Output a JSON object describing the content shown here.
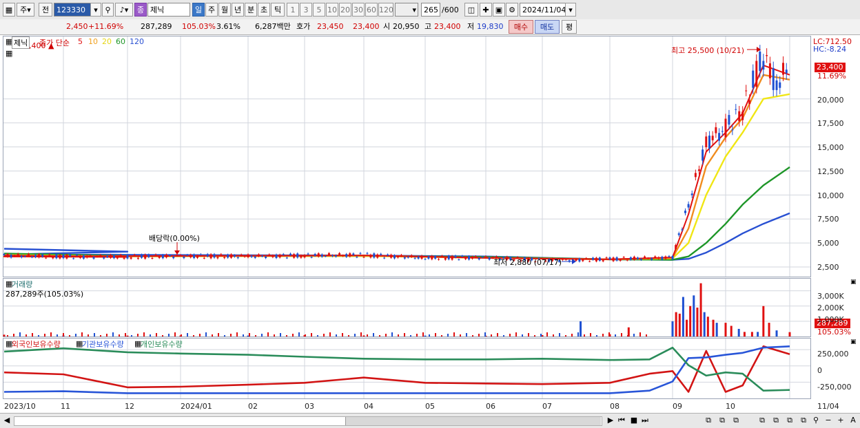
{
  "toolbar": {
    "market_label": "주",
    "prev_label": "전",
    "code": "123330",
    "name_badge": "종",
    "stock_name": "제닉",
    "periods": [
      "일",
      "주",
      "월",
      "년",
      "분",
      "초",
      "틱"
    ],
    "intervals": [
      "1",
      "3",
      "5",
      "10",
      "20",
      "30",
      "60",
      "120"
    ],
    "count": "265",
    "max_count": "/600",
    "date": "2024/11/04"
  },
  "quote": {
    "price": "23,400 ▲",
    "change": "2,450",
    "change_pct": "+11.69%",
    "volume": "287,289",
    "vol_ratio": "105.03%",
    "turnover": "3.61%",
    "amount": "6,287백만",
    "hoga_label": "호가",
    "ask": "23,450",
    "bid": "23,400",
    "open_label": "시",
    "open": "20,950",
    "high_label": "고",
    "high": "23,400",
    "low_label": "저",
    "low": "19,830",
    "buy_label": "매수",
    "sell_label": "매도",
    "avg_label": "평"
  },
  "price_panel": {
    "name": "제닉",
    "ma_title": "종가 단순",
    "ma_periods": [
      "5",
      "10",
      "20",
      "60",
      "120"
    ],
    "lc": "LC:712.50",
    "hc": "HC:-8.24",
    "high_annotation": "최고 25,500 (10/21)",
    "low_annotation": "최저 2,880 (07/17)",
    "dividend_annotation": "배당락(0.00%)",
    "current_tag": "23,400",
    "current_pct": "11.69%"
  },
  "volume_panel": {
    "title": "거래량",
    "info": "287,289주(105.03%)",
    "current_tag": "287,289",
    "current_pct": "105.03%"
  },
  "holding_panel": {
    "series_names": [
      "외국인보유수량",
      "기관보유수량",
      "개인보유수량"
    ]
  },
  "colors": {
    "ma5": "#e01010",
    "ma10": "#f08c1e",
    "ma20": "#f0e614",
    "ma60": "#1e9628",
    "ma120": "#2850d2",
    "up": "#e01010",
    "down": "#1e50d2",
    "foreign": "#d21414",
    "institution": "#2855d8",
    "individual": "#2a8c5a"
  },
  "chart_data": [
    {
      "type": "line",
      "title": "제닉 종가 단순 5 10 20 60 120",
      "categories": [
        "2023/10",
        "11",
        "12",
        "2024/01",
        "02",
        "03",
        "04",
        "05",
        "06",
        "07",
        "08",
        "09",
        "10",
        "11/04"
      ],
      "y_ticks": [
        2500,
        5000,
        7500,
        10000,
        12500,
        15000,
        17500,
        20000
      ],
      "ylim": [
        1500,
        26500
      ],
      "grid": true,
      "series": [
        {
          "name": "종가",
          "x": [
            "2023/10",
            "11",
            "12",
            "2024/01",
            "02",
            "03",
            "04",
            "05",
            "06",
            "07",
            "08",
            "09-01",
            "09-10",
            "09-20",
            "10-01",
            "10-10",
            "10-21",
            "10-28",
            "11/04"
          ],
          "values": [
            3700,
            3600,
            3550,
            3650,
            3600,
            3700,
            3750,
            3450,
            3500,
            3200,
            3300,
            3500,
            9000,
            15500,
            17000,
            18800,
            24500,
            21500,
            23400
          ]
        },
        {
          "name": "5",
          "x": [
            "2023/10",
            "12",
            "2024/02",
            "04",
            "06",
            "08",
            "09-01",
            "09-10",
            "09-20",
            "10-01",
            "10-10",
            "10-21",
            "11/04"
          ],
          "values": [
            3700,
            3550,
            3600,
            3700,
            3450,
            3300,
            3500,
            8000,
            14500,
            16500,
            18500,
            23500,
            22500
          ]
        },
        {
          "name": "10",
          "x": [
            "2023/10",
            "12",
            "2024/02",
            "04",
            "06",
            "08",
            "09-01",
            "09-10",
            "09-20",
            "10-01",
            "10-10",
            "10-21",
            "11/04"
          ],
          "values": [
            3700,
            3550,
            3600,
            3700,
            3450,
            3300,
            3450,
            6500,
            13000,
            16000,
            18000,
            22500,
            22000
          ]
        },
        {
          "name": "20",
          "x": [
            "2023/10",
            "12",
            "2024/02",
            "04",
            "06",
            "08",
            "09-01",
            "09-10",
            "09-20",
            "10-01",
            "10-10",
            "10-21",
            "11/04"
          ],
          "values": [
            3750,
            3600,
            3600,
            3650,
            3450,
            3300,
            3400,
            5000,
            10000,
            14000,
            16500,
            20000,
            20500
          ]
        },
        {
          "name": "60",
          "x": [
            "2023/10",
            "12",
            "2024/02",
            "04",
            "06",
            "08",
            "09-01",
            "09-10",
            "09-20",
            "10-01",
            "10-10",
            "10-21",
            "11/04"
          ],
          "values": [
            3900,
            3650,
            3600,
            3650,
            3550,
            3300,
            3250,
            3600,
            5000,
            7000,
            9000,
            11000,
            12900
          ]
        },
        {
          "name": "120",
          "x": [
            "2023/10",
            "12",
            "2024/02",
            "04",
            "06",
            "08",
            "09-01",
            "09-10",
            "09-20",
            "10-01",
            "10-10",
            "10-21",
            "11/04"
          ],
          "values": [
            4400,
            4100,
            3800,
            3700,
            3600,
            3300,
            3250,
            3350,
            4000,
            5000,
            6000,
            7000,
            8100
          ]
        }
      ]
    },
    {
      "type": "bar",
      "title": "거래량",
      "y_ticks": [
        1000000,
        2000000,
        3000000
      ],
      "ylim": [
        0,
        3800000
      ],
      "x": [
        "2023/10",
        "11",
        "12",
        "2024/01",
        "02",
        "03",
        "04",
        "05",
        "06",
        "07",
        "07-18",
        "08",
        "08-10",
        "09-01",
        "09-03",
        "09-05",
        "09-07",
        "09-09",
        "09-11",
        "09-13",
        "09-15",
        "09-17",
        "09-19",
        "09-21",
        "09-24",
        "09-26",
        "10-01",
        "10-04",
        "10-08",
        "10-11",
        "10-15",
        "10-18",
        "10-21",
        "10-24",
        "10-28",
        "11/04"
      ],
      "values": [
        120000,
        80000,
        60000,
        70000,
        60000,
        90000,
        70000,
        60000,
        50000,
        90000,
        1000000,
        150000,
        600000,
        1000000,
        1600000,
        1500000,
        2600000,
        1100000,
        2000000,
        2700000,
        1900000,
        3500000,
        1600000,
        1300000,
        1100000,
        900000,
        900000,
        700000,
        500000,
        300000,
        300000,
        300000,
        2000000,
        900000,
        400000,
        287289
      ]
    },
    {
      "type": "line",
      "title": "외국인보유수량 기관보유수량 개인보유수량",
      "y_ticks": [
        250000,
        0,
        -250000
      ],
      "ylim": [
        -500000,
        420000
      ],
      "series": [
        {
          "name": "외국인보유수량",
          "x": [
            "2023/10",
            "11",
            "12",
            "2024/01",
            "02",
            "03",
            "04",
            "05",
            "06",
            "07",
            "08",
            "08-20",
            "09-01",
            "09-10",
            "09-20",
            "10-01",
            "10-10",
            "10-21",
            "11/04"
          ],
          "values": [
            -100000,
            -130000,
            -330000,
            -320000,
            -290000,
            -260000,
            -180000,
            -260000,
            -270000,
            -280000,
            -260000,
            -120000,
            -80000,
            -400000,
            230000,
            -400000,
            -300000,
            300000,
            180000
          ]
        },
        {
          "name": "기관보유수량",
          "x": [
            "2023/10",
            "11",
            "12",
            "2024/01",
            "02",
            "03",
            "04",
            "05",
            "06",
            "07",
            "08",
            "08-20",
            "09-01",
            "09-10",
            "09-20",
            "10-01",
            "10-10",
            "10-21",
            "11/04"
          ],
          "values": [
            -400000,
            -390000,
            -420000,
            -420000,
            -420000,
            -420000,
            -420000,
            -420000,
            -420000,
            -420000,
            -420000,
            -380000,
            -240000,
            120000,
            130000,
            170000,
            200000,
            280000,
            300000
          ]
        },
        {
          "name": "개인보유수량",
          "x": [
            "2023/10",
            "11",
            "12",
            "2024/01",
            "02",
            "03",
            "04",
            "05",
            "06",
            "07",
            "08",
            "08-20",
            "09-01",
            "09-10",
            "09-20",
            "10-01",
            "10-10",
            "10-21",
            "11/04"
          ],
          "values": [
            220000,
            270000,
            210000,
            190000,
            170000,
            140000,
            110000,
            100000,
            100000,
            110000,
            90000,
            100000,
            280000,
            10000,
            -150000,
            -100000,
            -120000,
            -380000,
            -370000
          ]
        }
      ]
    }
  ],
  "bottom": {
    "nav_icons": [
      "play-icon",
      "first-icon",
      "stop-icon",
      "last-icon"
    ]
  }
}
